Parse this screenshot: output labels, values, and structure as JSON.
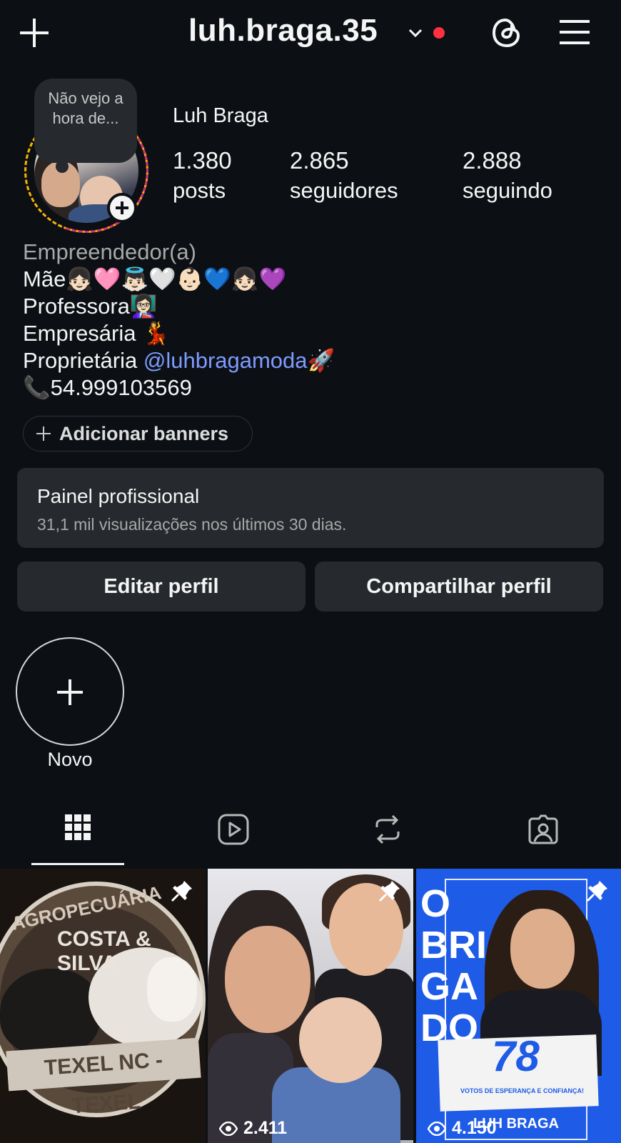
{
  "header": {
    "username": "luh.braga.35",
    "icons": [
      "plus-icon",
      "chevron-down-icon",
      "threads-icon",
      "menu-icon"
    ],
    "notification_dot_color": "#ff3040"
  },
  "profile": {
    "note": "Não vejo a hora de...",
    "display_name": "Luh Braga",
    "stats": [
      {
        "value": "1.380",
        "label": "posts"
      },
      {
        "value": "2.865",
        "label": "seguidores"
      },
      {
        "value": "2.888",
        "label": "seguindo"
      }
    ],
    "category": "Empreendedor(a)",
    "bio_lines": [
      "Mãe👧🏻🩷👼🏻🤍👶🏻💙👧🏻💜",
      "Professora👩🏻‍🏫",
      "Empresária 💃"
    ],
    "bio_owner_prefix": "Proprietária ",
    "bio_mention": "@luhbragamoda",
    "bio_owner_suffix": "🚀",
    "bio_phone": "📞54.999103569"
  },
  "actions": {
    "add_banners": "Adicionar banners",
    "panel_title": "Painel profissional",
    "panel_subtitle": "31,1 mil visualizações nos últimos 30 dias.",
    "edit_profile": "Editar perfil",
    "share_profile": "Compartilhar perfil"
  },
  "highlights": {
    "new_label": "Novo"
  },
  "tabs": [
    "grid-icon",
    "reels-icon",
    "reposts-icon",
    "tagged-icon"
  ],
  "grid": [
    {
      "pinned": true,
      "views": null,
      "art_text": {
        "title": "AGROPECUÁRIA",
        "subtitle": "COSTA & SILVA",
        "band": "TEXEL NC - TEXEL"
      }
    },
    {
      "pinned": true,
      "views": "2.411"
    },
    {
      "pinned": true,
      "views": "4.150",
      "art_text": {
        "letters": "O BRI GA DO",
        "number": "78",
        "small": "VOTOS DE ESPERANÇA E CONFIANÇA!",
        "name": "LUH BRAGA"
      }
    }
  ],
  "colors": {
    "background": "#0c1014",
    "card": "#262a2e",
    "mention": "#7e9bff"
  }
}
